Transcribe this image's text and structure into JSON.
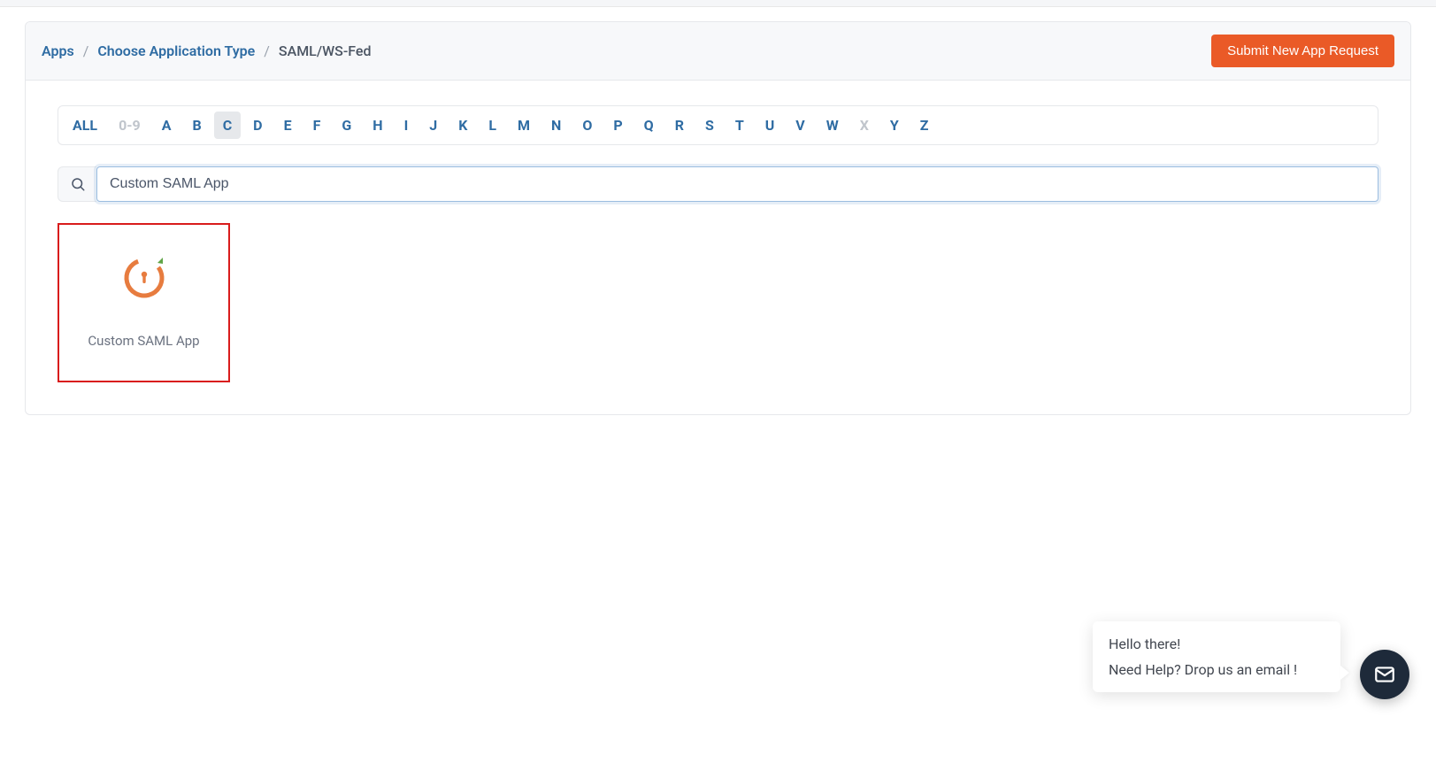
{
  "breadcrumbs": {
    "items": [
      {
        "label": "Apps",
        "active": false
      },
      {
        "label": "Choose Application Type",
        "active": false
      },
      {
        "label": "SAML/WS-Fed",
        "active": true
      }
    ]
  },
  "actions": {
    "submit_new_app": "Submit New App Request"
  },
  "alpha_filter": {
    "items": [
      {
        "label": "ALL",
        "state": "all"
      },
      {
        "label": "0-9",
        "state": "disabled"
      },
      {
        "label": "A",
        "state": "normal"
      },
      {
        "label": "B",
        "state": "normal"
      },
      {
        "label": "C",
        "state": "selected"
      },
      {
        "label": "D",
        "state": "normal"
      },
      {
        "label": "E",
        "state": "normal"
      },
      {
        "label": "F",
        "state": "normal"
      },
      {
        "label": "G",
        "state": "normal"
      },
      {
        "label": "H",
        "state": "normal"
      },
      {
        "label": "I",
        "state": "normal"
      },
      {
        "label": "J",
        "state": "normal"
      },
      {
        "label": "K",
        "state": "normal"
      },
      {
        "label": "L",
        "state": "normal"
      },
      {
        "label": "M",
        "state": "normal"
      },
      {
        "label": "N",
        "state": "normal"
      },
      {
        "label": "O",
        "state": "normal"
      },
      {
        "label": "P",
        "state": "normal"
      },
      {
        "label": "Q",
        "state": "normal"
      },
      {
        "label": "R",
        "state": "normal"
      },
      {
        "label": "S",
        "state": "normal"
      },
      {
        "label": "T",
        "state": "normal"
      },
      {
        "label": "U",
        "state": "normal"
      },
      {
        "label": "V",
        "state": "normal"
      },
      {
        "label": "W",
        "state": "normal"
      },
      {
        "label": "X",
        "state": "disabled"
      },
      {
        "label": "Y",
        "state": "normal"
      },
      {
        "label": "Z",
        "state": "normal"
      }
    ]
  },
  "search": {
    "value": "Custom SAML App",
    "placeholder": ""
  },
  "apps": {
    "items": [
      {
        "label": "Custom SAML App",
        "icon": "miniorange-lock-icon"
      }
    ]
  },
  "chat": {
    "line1": "Hello there!",
    "line2": "Need Help? Drop us an email !"
  },
  "colors": {
    "primary_action": "#ea5a27",
    "link": "#2f6ca3",
    "border": "#e6e8eb",
    "highlight_border": "#d91c1c",
    "fab_bg": "#1e2a3a"
  }
}
